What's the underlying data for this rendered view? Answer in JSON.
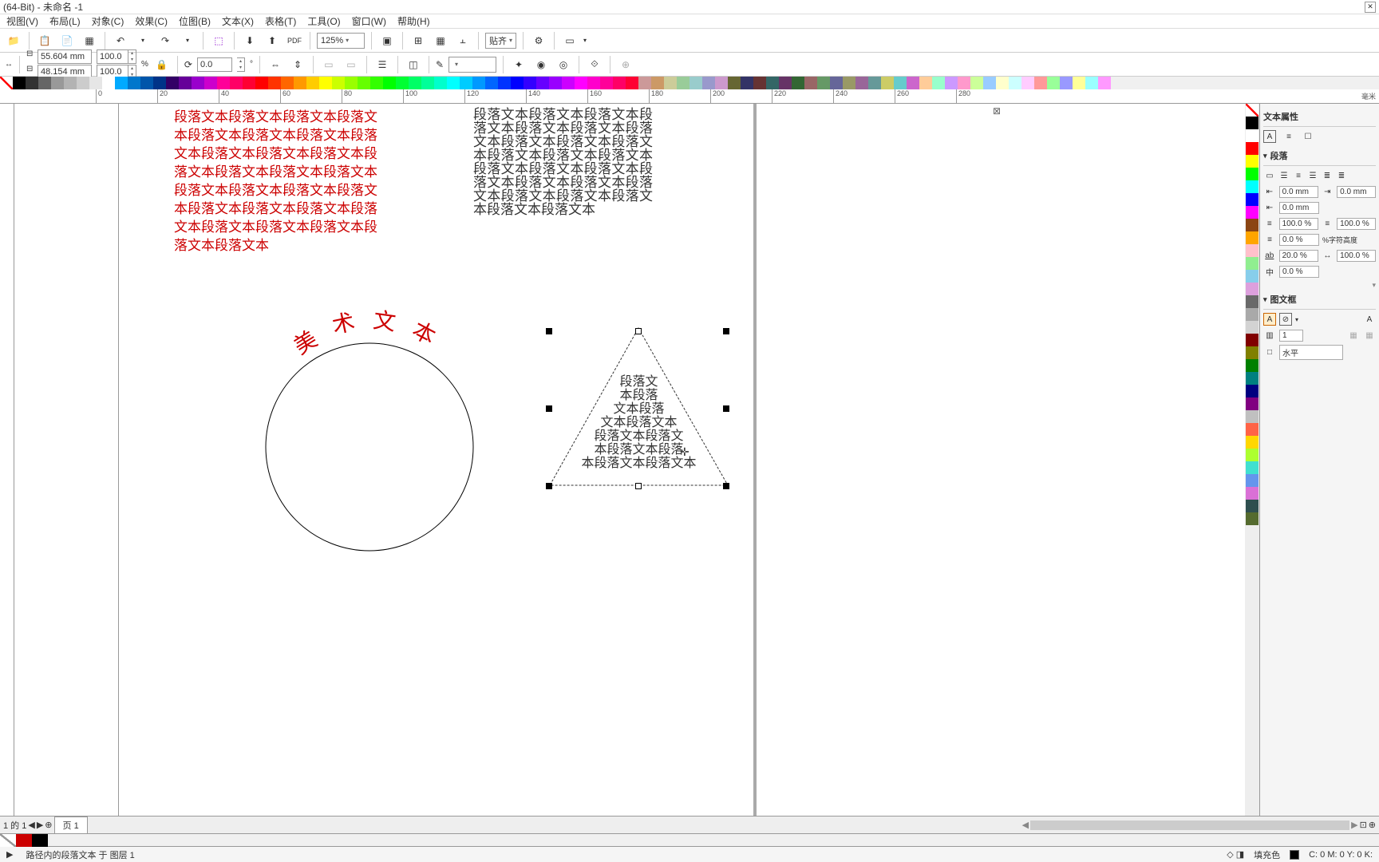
{
  "title": "(64-Bit) - 未命名 -1",
  "menu": [
    "视图(V)",
    "布局(L)",
    "对象(C)",
    "效果(C)",
    "位图(B)",
    "文本(X)",
    "表格(T)",
    "工具(O)",
    "窗口(W)",
    "帮助(H)"
  ],
  "toolbar1": {
    "zoom": "125%",
    "snap": "贴齐"
  },
  "toolbar2": {
    "w": "55.604 mm",
    "h": "48.154 mm",
    "sx": "100.0",
    "sy": "100.0",
    "pct": "%",
    "rot": "0.0"
  },
  "ruler_ticks": [
    0,
    20,
    40,
    60,
    80,
    100,
    120,
    140,
    160,
    180,
    200,
    220,
    240,
    260,
    280
  ],
  "ruler_unit": "毫米",
  "canvas": {
    "red_para": "段落文本段落文本段落文本段落文本段落文本段落文本段落文本段落文本段落文本段落文本段落文本段落文本段落文本段落文本段落文本段落文本段落文本段落文本段落文本段落文本段落文本段落文本段落文本段落文本段落文本段落文本段落文本段落文本",
    "black_para": "段落文本段落文本段落文本段落文本段落文本段落文本段落文本段落文本段落文本段落文本段落文本段落文本段落文本段落文本段落文本段落文本段落文本段落文本段落文本段落文本段落文本段落文本段落文本段落文本段落文本",
    "art_text": "美术文本",
    "tri_lines": [
      "段落文",
      "本段落",
      "文本段落",
      "文本段落文本",
      "段落文本段落文",
      "本段落文本段落",
      "本段落文本段落文本"
    ]
  },
  "props": {
    "title": "文本属性",
    "sec_para": "段落",
    "indent1": "0.0 mm",
    "indent2": "0.0 mm",
    "indent3": "0.0 mm",
    "line1": "100.0 %",
    "line2": "100.0 %",
    "sp1": "0.0 %",
    "sp_unit": "%字符高度",
    "ch1": "20.0 %",
    "ch2": "100.0 %",
    "ch3": "0.0 %",
    "sec_frame": "图文框",
    "cols": "1",
    "dir": "水平"
  },
  "tabs": {
    "nav": "1 的 1",
    "page": "页 1"
  },
  "status": {
    "msg": "路径内的段落文本 于 图层 1",
    "fill": "填充色",
    "color": "C: 0 M: 0 Y: 0 K:"
  },
  "palette_colors": [
    "#000000",
    "#1a1a1a",
    "#333333",
    "#666666",
    "#999999",
    "#cccccc",
    "#ffffff",
    "#00a0e9",
    "#0068b7",
    "#1d2088",
    "#601986",
    "#920783",
    "#e4007f",
    "#e5004f",
    "#e60012",
    "#eb6100",
    "#f39800",
    "#fcc800",
    "#fff100",
    "#cfdb00",
    "#8fc31f",
    "#22ac38",
    "#009944",
    "#009b6b",
    "#009e96",
    "#00a0c6"
  ],
  "big_palette": [
    "#000",
    "#333",
    "#666",
    "#999",
    "#b3b3b3",
    "#ccc",
    "#e6e6e6",
    "#fff",
    "#0af",
    "#07c",
    "#05a",
    "#038",
    "#306",
    "#609",
    "#90c",
    "#c0c",
    "#f09",
    "#f06",
    "#f03",
    "#f00",
    "#f30",
    "#f60",
    "#f90",
    "#fc0",
    "#ff0",
    "#cf0",
    "#9f0",
    "#6f0",
    "#3f0",
    "#0f0",
    "#0f3",
    "#0f6",
    "#0f9",
    "#0fc",
    "#0ff",
    "#0cf",
    "#09f",
    "#06f",
    "#03f",
    "#00f",
    "#30f",
    "#60f",
    "#90f",
    "#c0f",
    "#f0f",
    "#f0c",
    "#f09",
    "#f06",
    "#f03",
    "#c99",
    "#c96",
    "#cc9",
    "#9c9",
    "#9cc",
    "#99c",
    "#c9c",
    "#663",
    "#336",
    "#633",
    "#366",
    "#636",
    "#363",
    "#966",
    "#696",
    "#669",
    "#996",
    "#969",
    "#699",
    "#cc6",
    "#6cc",
    "#c6c",
    "#fc9",
    "#9fc",
    "#c9f",
    "#f9c",
    "#cf9",
    "#9cf",
    "#ffc",
    "#cff",
    "#fcf",
    "#f99",
    "#9f9",
    "#99f",
    "#ff9",
    "#9ff",
    "#f9f"
  ],
  "right_palette": [
    "#000",
    "#fff",
    "#f00",
    "#ff0",
    "#0f0",
    "#0ff",
    "#00f",
    "#f0f",
    "#8b4513",
    "#ffa500",
    "#ffc0cb",
    "#90ee90",
    "#87ceeb",
    "#dda0dd",
    "#696969",
    "#a9a9a9",
    "#d3d3d3",
    "#800000",
    "#808000",
    "#008000",
    "#008080",
    "#000080",
    "#800080",
    "#c0c0c0",
    "#ff6347",
    "#ffd700",
    "#adff2f",
    "#40e0d0",
    "#6495ed",
    "#da70d6",
    "#2f4f4f",
    "#556b2f"
  ]
}
